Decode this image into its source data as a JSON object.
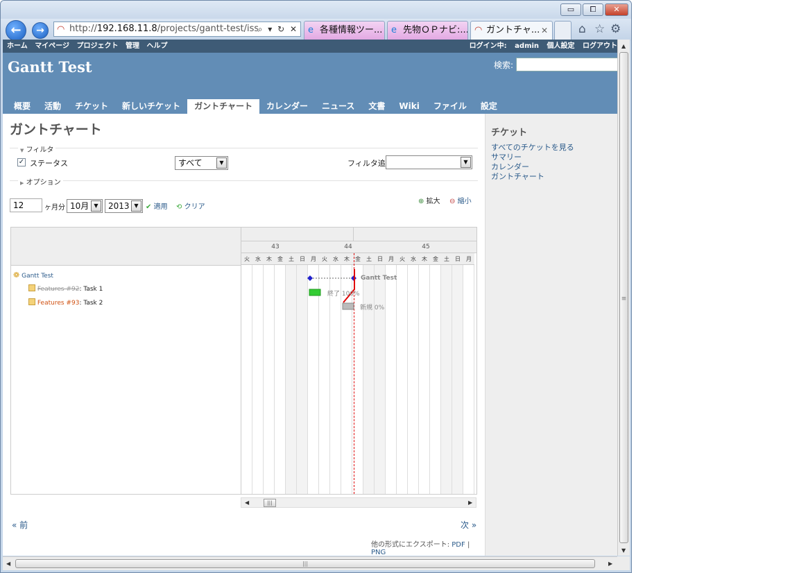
{
  "browser": {
    "window_controls": {
      "minimize": "▭",
      "maximize": "⧠",
      "close": "✕"
    },
    "back": "←",
    "forward": "→",
    "address_scheme": "http://",
    "address_host": "192.168.11.8",
    "address_path": "/projects/gantt-test/issu",
    "address_tools": "⌕ ▾ ↻ ✕",
    "tabs": [
      {
        "label": "各種情報ツー..."
      },
      {
        "label": "先物ＯＰナビ:..."
      },
      {
        "label": "ガントチャ...",
        "close": "✕"
      }
    ],
    "toolbar_icons": {
      "home": "⌂",
      "favorites": "☆",
      "settings": "⚙"
    }
  },
  "top_menu": {
    "items": [
      "ホーム",
      "マイページ",
      "プロジェクト",
      "管理",
      "ヘルプ"
    ],
    "logged_in_prefix": "ログイン中:",
    "logged_in_user": "admin",
    "my_account": "個人設定",
    "sign_out": "ログアウト"
  },
  "header": {
    "project_title": "Gantt Test",
    "search_label": "検索:"
  },
  "main_menu": [
    "概要",
    "活動",
    "チケット",
    "新しいチケット",
    "ガントチャート",
    "カレンダー",
    "ニュース",
    "文書",
    "Wiki",
    "ファイル",
    "設定"
  ],
  "page_title": "ガントチャート",
  "filters": {
    "legend": "フィルタ",
    "status_label": "ステータス",
    "status_value": "すべて",
    "add_filter_label": "フィルタ追加",
    "options_legend": "オプション",
    "months_value": "12",
    "months_suffix": "ヶ月分",
    "month_value": "10月",
    "year_value": "2013",
    "apply": "適用",
    "clear": "クリア",
    "zoom_in": "拡大",
    "zoom_out": "縮小"
  },
  "gantt": {
    "weeks": [
      "43",
      "44",
      "45"
    ],
    "days": [
      "火",
      "水",
      "木",
      "金",
      "土",
      "日",
      "月",
      "火",
      "水",
      "木",
      "金",
      "土",
      "日",
      "月",
      "火",
      "水",
      "木",
      "金",
      "土",
      "日",
      "月"
    ],
    "subjects": [
      {
        "project": "Gantt Test"
      },
      {
        "tracker": "Features #92",
        "subject": ": Task 1"
      },
      {
        "tracker": "Features #93",
        "subject": ": Task 2"
      }
    ],
    "bar_labels": {
      "project": "Gantt Test",
      "task1": "終了 100%",
      "task2": "新規 0%"
    },
    "progress": {
      "task1": 100,
      "task2": 0
    }
  },
  "pagination": {
    "prev": "« 前",
    "next": "次 »"
  },
  "export": {
    "label": "他の形式にエクスポート:",
    "pdf": "PDF",
    "sep": "|",
    "png": "PNG"
  },
  "sidebar": {
    "title": "チケット",
    "links": [
      "すべてのチケットを見る",
      "サマリー",
      "カレンダー",
      "ガントチャート"
    ]
  },
  "colors": {
    "header": "#628db6",
    "top_menu": "#3e5b76",
    "link": "#2a5a8a",
    "done_bar": "#33cc33",
    "today_line": "#dd0000"
  }
}
